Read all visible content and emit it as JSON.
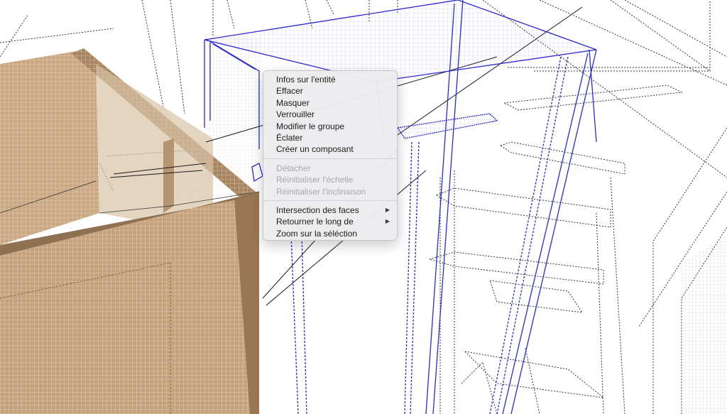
{
  "context_menu": {
    "group1": [
      {
        "label": "Infos sur l'entité",
        "enabled": true
      },
      {
        "label": "Effacer",
        "enabled": true
      },
      {
        "label": "Masquer",
        "enabled": true
      },
      {
        "label": "Verrouiller",
        "enabled": true
      },
      {
        "label": "Modifier le groupe",
        "enabled": true
      },
      {
        "label": "Éclater",
        "enabled": true
      },
      {
        "label": "Créer un composant",
        "enabled": true
      }
    ],
    "group2": [
      {
        "label": "Détacher",
        "enabled": false
      },
      {
        "label": "Réinitialiser l'échelle",
        "enabled": false
      },
      {
        "label": "Réinitialiser l'inclinaison",
        "enabled": false
      }
    ],
    "group3": [
      {
        "label": "Intersection des faces",
        "enabled": true,
        "submenu": true
      },
      {
        "label": "Retourner le long de",
        "enabled": true,
        "submenu": true
      },
      {
        "label": "Zoom sur la séléction",
        "enabled": true
      }
    ],
    "submenu_glyph": "▶"
  },
  "viewport": {
    "selection_color": "#2a2ad0",
    "wood_color": "#c9a882",
    "wood_dark_color": "#8e7052",
    "edge_color": "#2b2b2b"
  }
}
